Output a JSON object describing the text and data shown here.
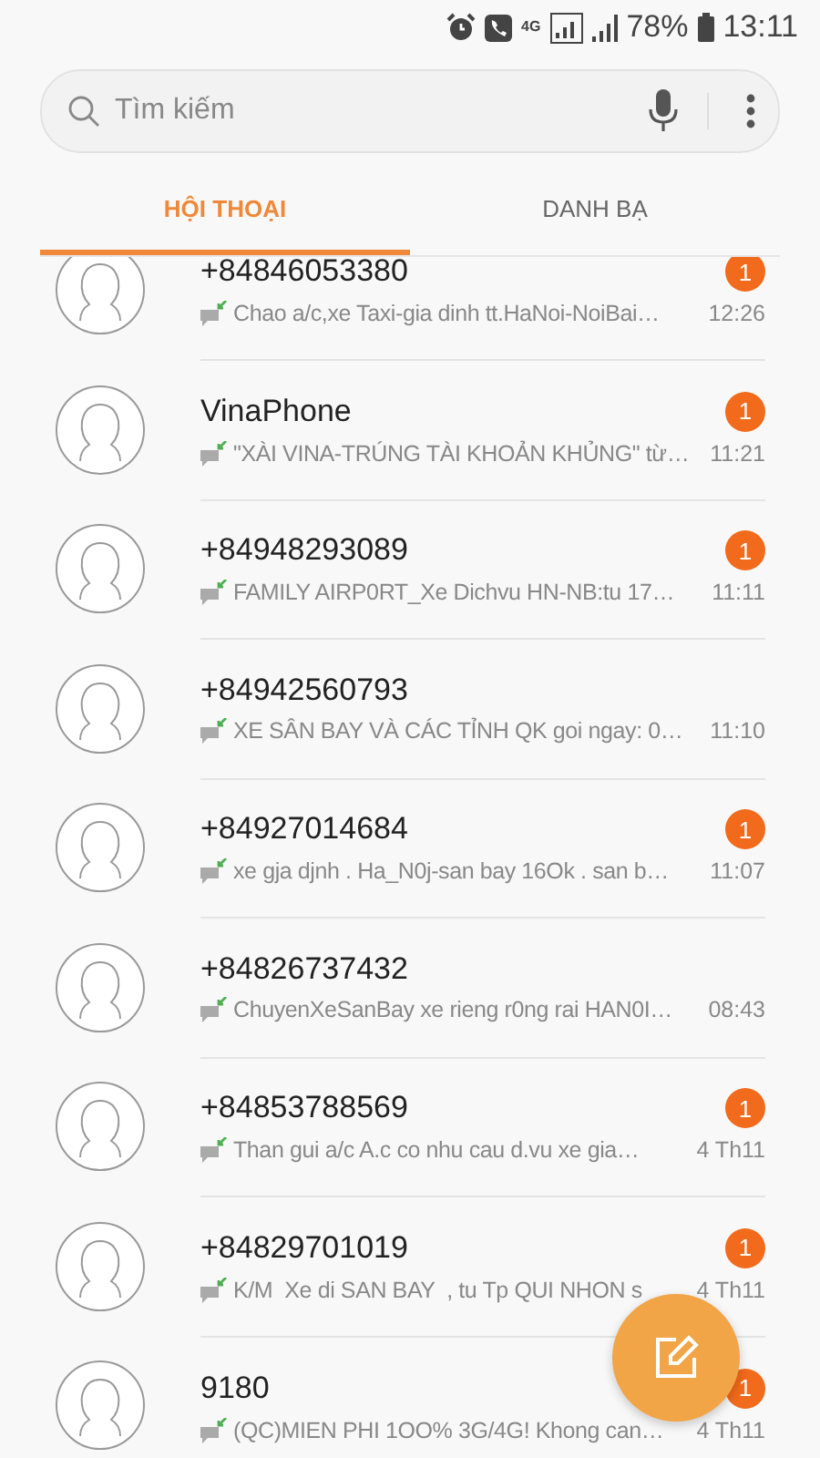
{
  "status_bar": {
    "network": "4G",
    "battery": "78%",
    "time": "13:11"
  },
  "search": {
    "placeholder": "Tìm kiếm"
  },
  "tabs": [
    {
      "label": "HỘI THOẠI",
      "selected": true
    },
    {
      "label": "DANH BẠ",
      "selected": false
    }
  ],
  "conversations": [
    {
      "name": "+84846053380",
      "preview": "Chao a/c,xe Taxi-gia dinh tt.HaNoi-NoiBai…",
      "time": "12:26",
      "unread": "1"
    },
    {
      "name": "VinaPhone",
      "preview": "\"XÀI VINA-TRÚNG TÀI KHOẢN KHỦNG\" từ…",
      "time": "11:21",
      "unread": "1"
    },
    {
      "name": "+84948293089",
      "preview": "FAMILY AIRP0RT_Xe Dichvu HN-NB:tu 17…",
      "time": "11:11",
      "unread": "1"
    },
    {
      "name": "+84942560793",
      "preview": "XE SÂN BAY VÀ CÁC TỈNH QK goi ngay: 0…",
      "time": "11:10"
    },
    {
      "name": "+84927014684",
      "preview": "xe gja djnh . Ha_N0j-san bay 16Ok . san b…",
      "time": "11:07",
      "unread": "1"
    },
    {
      "name": "+84826737432",
      "preview": "ChuyenXeSanBay xe rieng r0ng rai HAN0I…",
      "time": "08:43"
    },
    {
      "name": "+84853788569",
      "preview": "Than gui a/c A.c co nhu cau d.vu xe gia…",
      "time": "4 Th11",
      "unread": "1"
    },
    {
      "name": "+84829701019",
      "preview": "K/M  Xe di SAN BAY  , tu Tp QUI NHON s",
      "time": "4 Th11",
      "unread": "1"
    },
    {
      "name": "9180",
      "preview": "(QC)MIEN PHI 1OO% 3G/4G! Khong can…",
      "time": "4 Th11",
      "unread": "1"
    }
  ]
}
